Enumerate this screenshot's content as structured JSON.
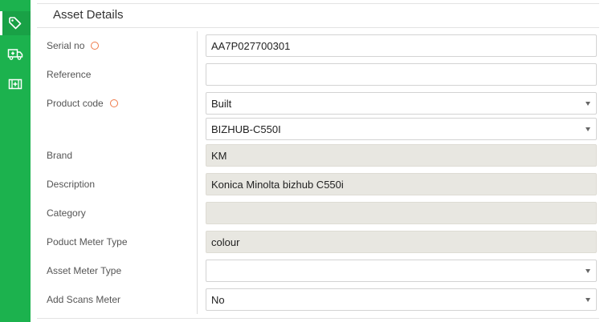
{
  "sidebar": {
    "items": [
      {
        "icon": "tag-icon",
        "active": true
      },
      {
        "icon": "ambulance-icon",
        "active": false
      },
      {
        "icon": "medical-kit-icon",
        "active": false
      }
    ]
  },
  "panel": {
    "title": "Asset Details"
  },
  "fields": {
    "serial_no": {
      "label": "Serial no",
      "value": "AA7P027700301"
    },
    "reference": {
      "label": "Reference",
      "value": ""
    },
    "product_code": {
      "label": "Product code",
      "value": "Built"
    },
    "model": {
      "value": "BIZHUB-C550I"
    },
    "brand": {
      "label": "Brand",
      "value": "KM"
    },
    "description": {
      "label": "Description",
      "value": "Konica Minolta bizhub C550i"
    },
    "category": {
      "label": "Category",
      "value": ""
    },
    "product_meter_type": {
      "label": "Poduct Meter Type",
      "value": "colour"
    },
    "asset_meter_type": {
      "label": "Asset Meter Type",
      "value": ""
    },
    "add_scans_meter": {
      "label": "Add Scans Meter",
      "value": "No"
    }
  },
  "colors": {
    "sidebar": "#1cb24e",
    "required_marker": "#ef7a4a",
    "readonly_bg": "#e8e7e1"
  }
}
